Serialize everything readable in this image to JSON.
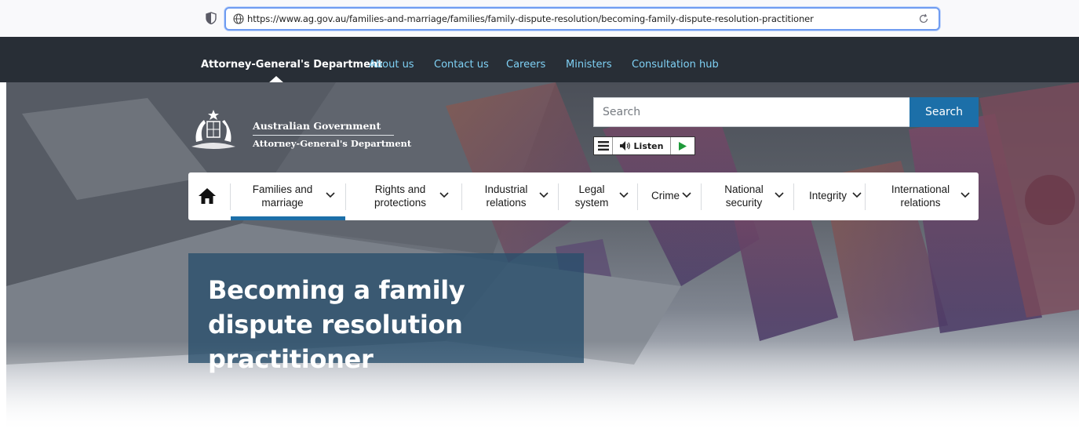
{
  "browser": {
    "url": "https://www.ag.gov.au/families-and-marriage/families/family-dispute-resolution/becoming-family-dispute-resolution-practitioner"
  },
  "top_nav": {
    "brand": "Attorney-General's Department",
    "links": [
      "About us",
      "Contact us",
      "Careers",
      "Ministers",
      "Consultation hub"
    ]
  },
  "logo": {
    "line1": "Australian Government",
    "line2": "Attorney-General's Department"
  },
  "search": {
    "placeholder": "Search",
    "button_label": "Search"
  },
  "listen_bar": {
    "listen_label": "Listen"
  },
  "main_menu": {
    "items": [
      {
        "label": "Families and marriage",
        "active": true
      },
      {
        "label": "Rights and protections"
      },
      {
        "label": "Industrial relations"
      },
      {
        "label": "Legal system"
      },
      {
        "label": "Crime"
      },
      {
        "label": "National security"
      },
      {
        "label": "Integrity"
      },
      {
        "label": "International relations"
      }
    ]
  },
  "hero": {
    "title": "Becoming a family dispute resolution practitioner"
  },
  "colors": {
    "top_nav_bg": "#282e36",
    "top_nav_link": "#7fd1f5",
    "accent": "#1c6fa8",
    "title_box": "#284e6c"
  }
}
